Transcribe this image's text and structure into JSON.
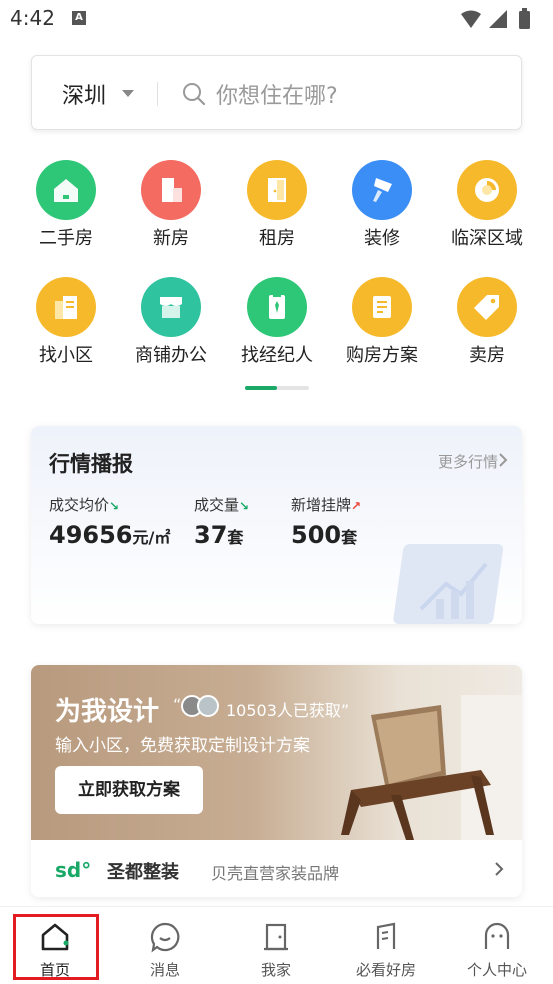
{
  "status_bar": {
    "time": "4:42",
    "notification_glyph": "A"
  },
  "search": {
    "city": "深圳",
    "placeholder": "你想住在哪?"
  },
  "grid": [
    {
      "label": "二手房",
      "color": "#2ec777",
      "icon": "house-icon"
    },
    {
      "label": "新房",
      "color": "#f46b61",
      "icon": "building-icon"
    },
    {
      "label": "租房",
      "color": "#f6b92b",
      "icon": "door-icon"
    },
    {
      "label": "装修",
      "color": "#3a8ef6",
      "icon": "paintbrush-icon"
    },
    {
      "label": "临深区域",
      "color": "#f6b92b",
      "icon": "pie-chart-icon"
    },
    {
      "label": "找小区",
      "color": "#f6b92b",
      "icon": "community-icon"
    },
    {
      "label": "商铺办公",
      "color": "#2fc39f",
      "icon": "shop-icon"
    },
    {
      "label": "找经纪人",
      "color": "#2ec777",
      "icon": "agent-icon"
    },
    {
      "label": "购房方案",
      "color": "#f6b92b",
      "icon": "document-icon"
    },
    {
      "label": "卖房",
      "color": "#f6b92b",
      "icon": "tag-icon"
    }
  ],
  "market": {
    "title": "行情播报",
    "more": "更多行情",
    "stats": [
      {
        "label": "成交均价",
        "value": "49656",
        "unit": "元/㎡",
        "trend": "down"
      },
      {
        "label": "成交量",
        "value": "37",
        "unit": "套",
        "trend": "down"
      },
      {
        "label": "新增挂牌",
        "value": "500",
        "unit": "套",
        "trend": "up"
      }
    ]
  },
  "design": {
    "title": "为我设计",
    "open_quote": "“",
    "count_text": "10503人已获取”",
    "subtitle": "输入小区，免费获取定制设计方案",
    "button": "立即获取方案",
    "brand_logo": "sd°",
    "brand_name": "圣都整装",
    "brand_desc": "贝壳直营家装品牌"
  },
  "bottom_nav": [
    {
      "label": "首页",
      "icon": "home-icon",
      "active": true
    },
    {
      "label": "消息",
      "icon": "message-icon",
      "active": false
    },
    {
      "label": "我家",
      "icon": "my-home-icon",
      "active": false
    },
    {
      "label": "必看好房",
      "icon": "building-icon",
      "active": false
    },
    {
      "label": "个人中心",
      "icon": "profile-icon",
      "active": false
    }
  ],
  "colors": {
    "accent": "#1aa867",
    "down": "#1aa867",
    "up": "#e9453b",
    "highlight": "#e31b23"
  }
}
